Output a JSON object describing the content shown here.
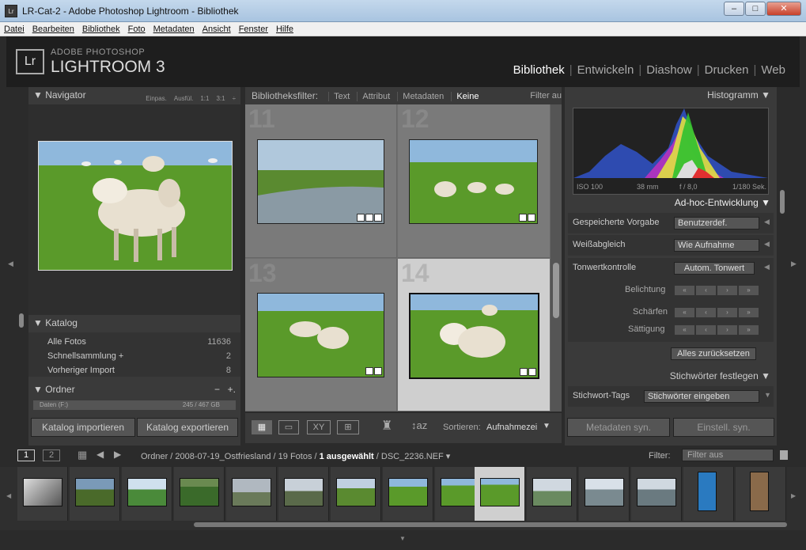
{
  "window": {
    "title": "LR-Cat-2 - Adobe Photoshop Lightroom - Bibliothek",
    "app_icon": "Lr",
    "minimize": "–",
    "maximize": "□",
    "close": "✕"
  },
  "menu": [
    "Datei",
    "Bearbeiten",
    "Bibliothek",
    "Foto",
    "Metadaten",
    "Ansicht",
    "Fenster",
    "Hilfe"
  ],
  "brand": {
    "logo": "Lr",
    "line1": "ADOBE PHOTOSHOP",
    "line2": "LIGHTROOM 3"
  },
  "modules": [
    {
      "label": "Bibliothek",
      "active": true
    },
    {
      "label": "Entwickeln",
      "active": false
    },
    {
      "label": "Diashow",
      "active": false
    },
    {
      "label": "Drucken",
      "active": false
    },
    {
      "label": "Web",
      "active": false
    }
  ],
  "navigator": {
    "title": "Navigator",
    "options": [
      "Einpas.",
      "Ausfül.",
      "1:1",
      "3:1"
    ]
  },
  "katalog": {
    "title": "Katalog",
    "items": [
      {
        "label": "Alle Fotos",
        "count": "11636"
      },
      {
        "label": "Schnellsammlung +",
        "count": "2"
      },
      {
        "label": "Vorheriger Import",
        "count": "8"
      }
    ]
  },
  "ordner": {
    "title": "Ordner",
    "row_label": "Daten (F:)",
    "row_size": "245 / 467 GB",
    "minus": "−",
    "plus": "+."
  },
  "left_buttons": {
    "import": "Katalog importieren",
    "export": "Katalog exportieren"
  },
  "filterbar": {
    "label": "Bibliotheksfilter:",
    "options": [
      "Text",
      "Attribut",
      "Metadaten",
      "Keine"
    ],
    "active": "Keine",
    "right": "Filter au"
  },
  "grid": {
    "cells": [
      "11",
      "12",
      "13",
      "14"
    ]
  },
  "toolbar": {
    "sort_label": "Sortieren:",
    "sort_value": "Aufnahmezei"
  },
  "right": {
    "histogram_title": "Histogramm",
    "histo_info": [
      "ISO 100",
      "38 mm",
      "f / 8,0",
      "1/180 Sek."
    ],
    "quick_title": "Ad-hoc-Entwicklung",
    "preset_label": "Gespeicherte Vorgabe",
    "preset_value": "Benutzerdef.",
    "wb_label": "Weißabgleich",
    "wb_value": "Wie Aufnahme",
    "tone_label": "Tonwertkontrolle",
    "auto_tone": "Autom. Tonwert",
    "exposure": "Belichtung",
    "sharpen": "Schärfen",
    "saturation": "Sättigung",
    "reset": "Alles zurücksetzen",
    "keyword_title": "Stichwörter festlegen",
    "keyword_label": "Stichwort-Tags",
    "keyword_value": "Stichwörter eingeben",
    "sync_meta": "Metadaten syn.",
    "sync_settings": "Einstell. syn."
  },
  "steps": {
    "a": "«",
    "b": "‹",
    "c": "›",
    "d": "»"
  },
  "filmbar": {
    "page1": "1",
    "page2": "2",
    "path": "Ordner / 2008-07-19_Ostfriesland / 19 Fotos / ",
    "selected": "1 ausgewählt",
    "file": " / DSC_2236.NEF",
    "filter_label": "Filter:",
    "filter_value": "Filter aus"
  },
  "colors": {
    "sky": "#6fa8dc",
    "grass": "#5a9a2a",
    "water": "#8a9aa4",
    "sheep": "#e8e0d0",
    "accent_active": "#ffffff"
  }
}
